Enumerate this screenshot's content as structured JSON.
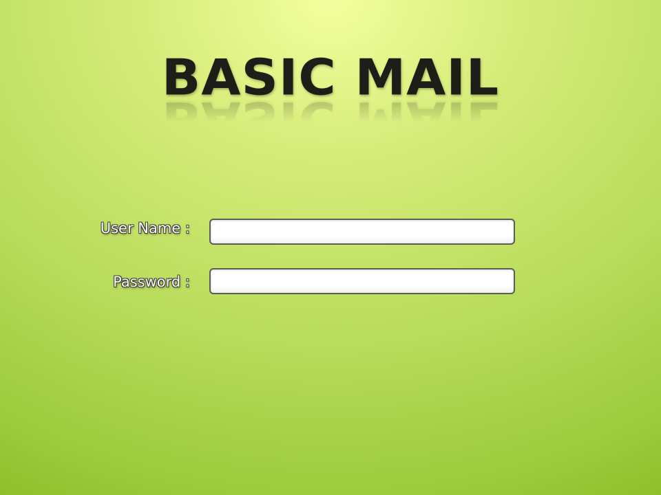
{
  "app": {
    "title": "BASIC MAIL"
  },
  "login_form": {
    "username_label": "User Name :",
    "username_value": "",
    "password_label": "Password :",
    "password_value": ""
  },
  "colors": {
    "background_light": "#f2ff9e",
    "background_dark": "#84b51d",
    "title_text": "#1e1e18",
    "input_border": "#5d5d55"
  }
}
